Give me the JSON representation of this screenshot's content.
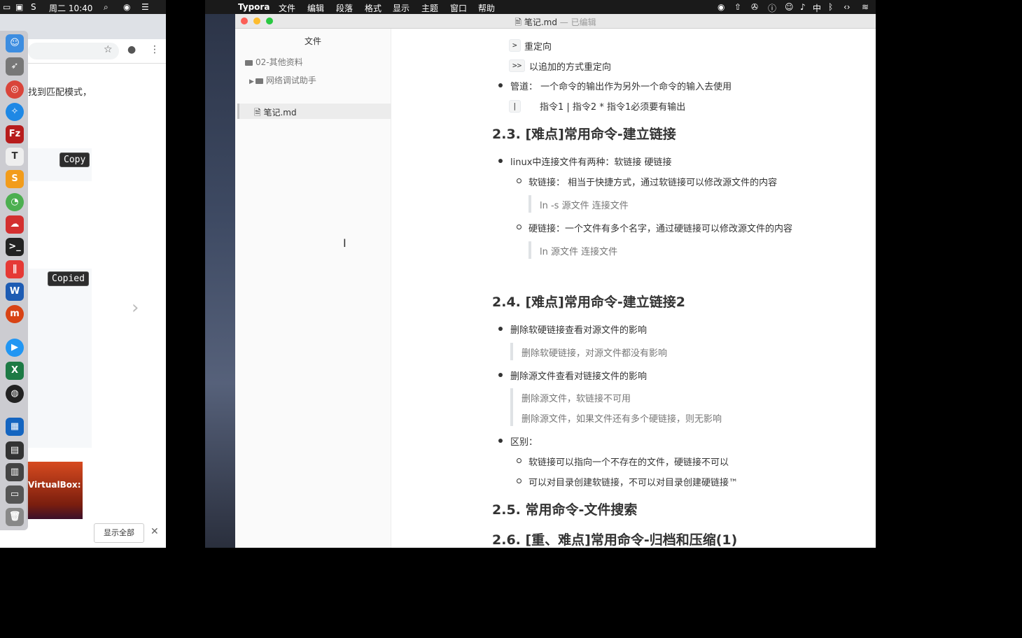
{
  "left_menubar": {
    "battery": "",
    "clock": "周二 10:40"
  },
  "browser": {
    "content_text": "找到匹配模式，",
    "copy_label": "Copy",
    "copied_label": "Copied",
    "vbox_label": "VirtualBox: ~",
    "show_all": "显示全部",
    "close": "✕",
    "chevron": "›"
  },
  "dock_icons": [
    "finder-icon",
    "launchpad-icon",
    "chrome-icon",
    "safari-icon",
    "filezilla-icon",
    "typora-icon",
    "sublime-icon",
    "wechat-icon",
    "baidu-netdisk-icon",
    "terminal-icon",
    "parallels-icon",
    "word-icon",
    "pdf-reader-icon",
    "quicktime-icon",
    "excel-icon",
    "obs-icon",
    "remote-desktop-icon",
    "terminal-preview-icon",
    "sublime-preview-icon",
    "screen-preview-icon",
    "trash-icon"
  ],
  "mac_menubar": {
    "app": "Typora",
    "menus": [
      "文件",
      "编辑",
      "段落",
      "格式",
      "显示",
      "主题",
      "窗口",
      "帮助"
    ],
    "ime": "中"
  },
  "window": {
    "title": "笔记.md",
    "subtitle": " — 已编辑"
  },
  "sidebar": {
    "title": "文件",
    "items": [
      {
        "label": "02-其他资料"
      },
      {
        "label": "网络调试助手"
      },
      {
        "label": "笔记.md"
      }
    ]
  },
  "editor": {
    "redirect_code": ">",
    "redirect_text": "重定向",
    "append_code": ">>",
    "append_text": "以追加的方式重定向",
    "pipe_item": "管道： 一个命令的输出作为另外一个命令的输入去使用",
    "pipe_code": "|",
    "pipe_example": "指令1 | 指令2        * 指令1必须要有输出",
    "h2_3": "2.3. [难点]常用命令-建立链接",
    "link_item": "linux中连接文件有两种：软链接  硬链接",
    "soft_item": "软链接： 相当于快捷方式，通过软链接可以修改源文件的内容",
    "soft_quote": "ln -s 源文件  连接文件",
    "hard_item": "硬链接：一个文件有多个名字，通过硬链接可以修改源文件的内容",
    "hard_quote": "ln 源文件  连接文件",
    "h2_4": "2.4. [难点]常用命令-建立链接2",
    "del_link_item": "删除软硬链接查看对源文件的影响",
    "del_link_quote": "删除软硬链接，对源文件都没有影响",
    "del_src_item": "删除源文件查看对链接文件的影响",
    "del_src_quote1": "删除源文件，软链接不可用",
    "del_src_quote2": "删除源文件，如果文件还有多个硬链接，则无影响",
    "diff_item": "区别：",
    "diff_sub1": "软链接可以指向一个不存在的文件，硬链接不可以",
    "diff_sub2": "可以对目录创建软链接，不可以对目录创建硬链接™",
    "h2_5": "2.5. 常用命令-文件搜索",
    "h2_6": "2.6. [重、难点]常用命令-归档和压缩(1)"
  }
}
